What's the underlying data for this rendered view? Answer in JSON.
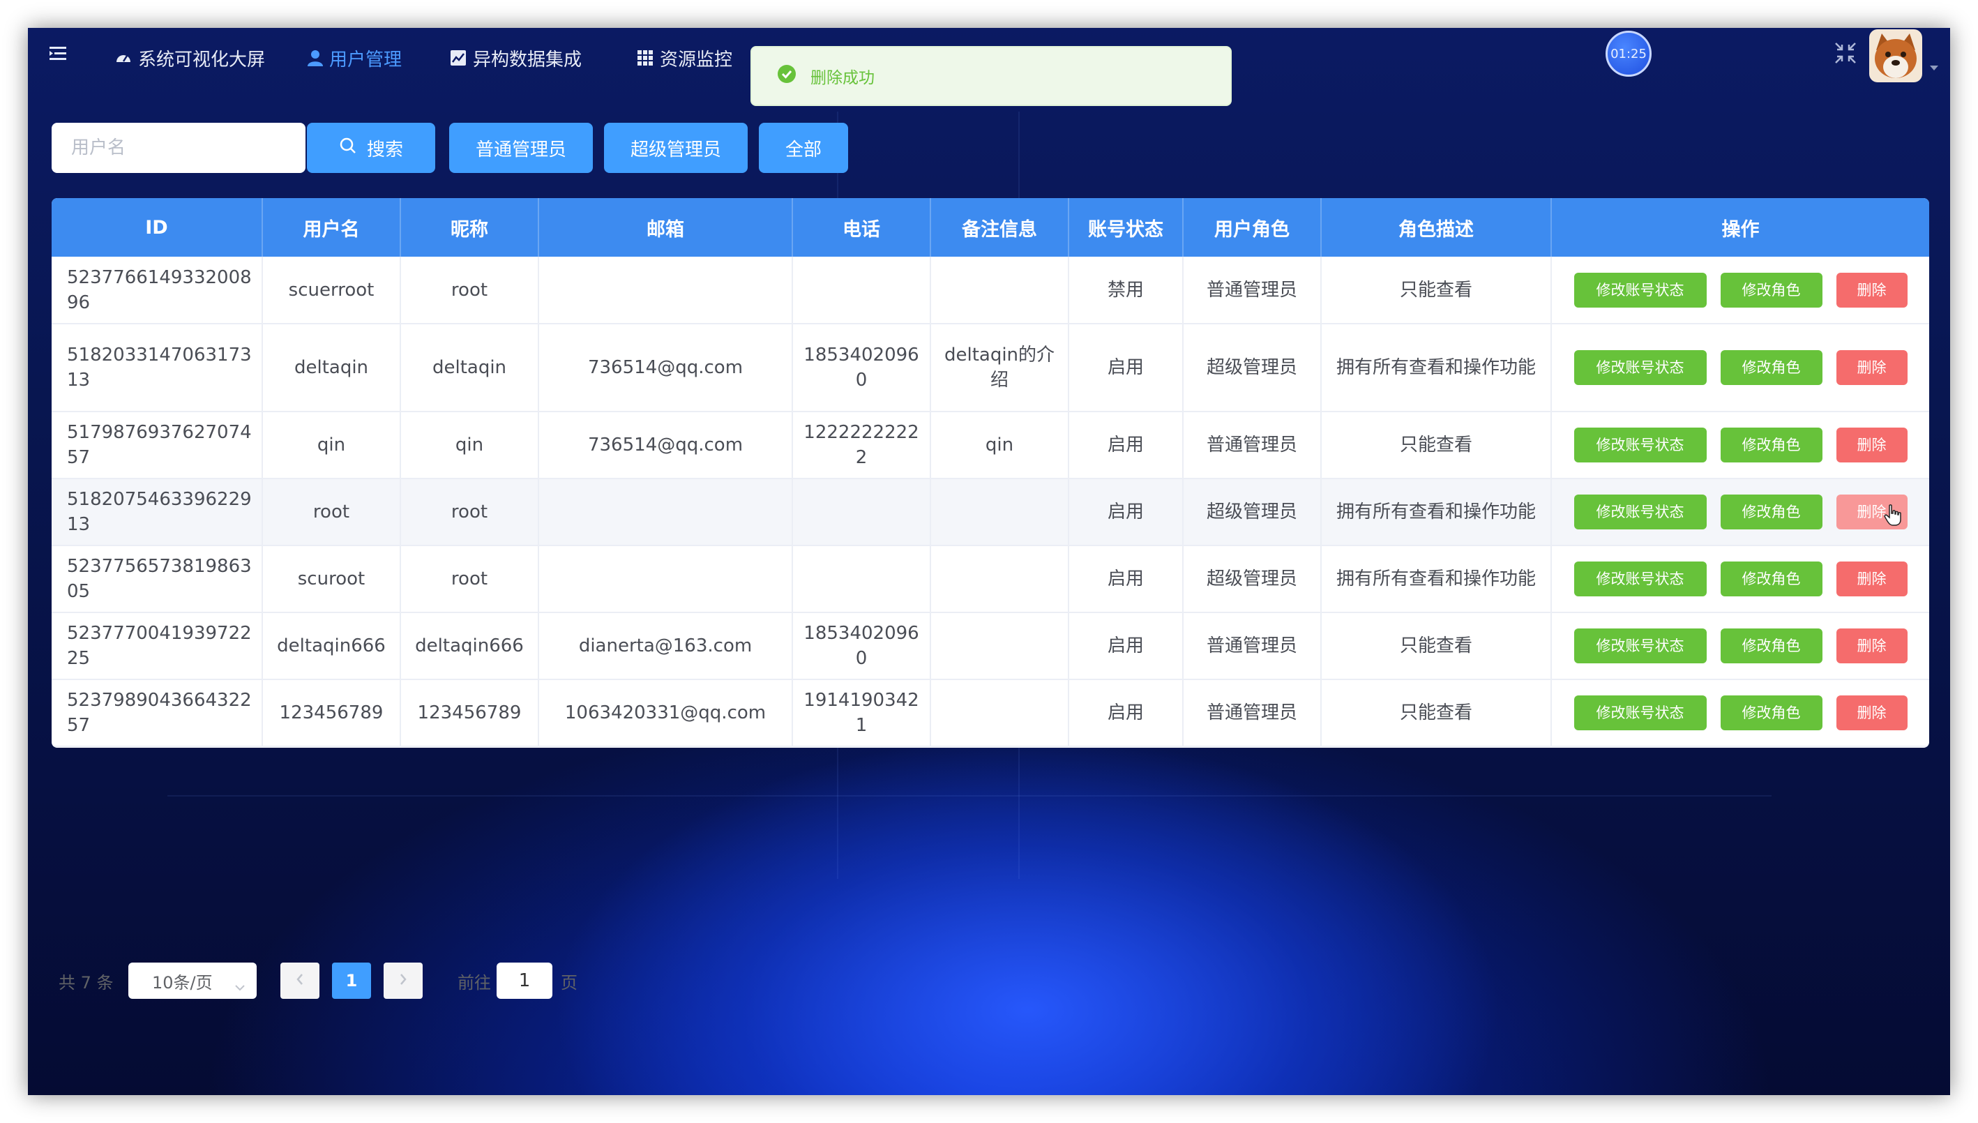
{
  "nav": {
    "items": [
      {
        "label": "系统可视化大屏",
        "icon": "dashboard-icon"
      },
      {
        "label": "用户管理",
        "icon": "user-icon"
      },
      {
        "label": "异构数据集成",
        "icon": "chart-icon"
      },
      {
        "label": "资源监控",
        "icon": "grid-icon"
      }
    ],
    "active_index": 1
  },
  "toast": {
    "message": "删除成功",
    "type": "success",
    "color": "#67c23a"
  },
  "timer": {
    "text": "01:25"
  },
  "search": {
    "placeholder": "用户名",
    "value": "",
    "search_label": "搜索",
    "filter_normal_label": "普通管理员",
    "filter_super_label": "超级管理员",
    "filter_all_label": "全部"
  },
  "table": {
    "columns": [
      "ID",
      "用户名",
      "昵称",
      "邮箱",
      "电话",
      "备注信息",
      "账号状态",
      "用户角色",
      "角色描述",
      "操作"
    ],
    "action_labels": {
      "status": "修改账号状态",
      "role": "修改角色",
      "delete": "删除"
    },
    "rows": [
      {
        "id": "523776614933200896",
        "username": "scuerroot",
        "nickname": "root",
        "email": "",
        "phone": "",
        "note": "",
        "status": "禁用",
        "role": "普通管理员",
        "desc": "只能查看"
      },
      {
        "id": "518203314706317313",
        "username": "deltaqin",
        "nickname": "deltaqin",
        "email": "736514@qq.com",
        "phone": "18534020960",
        "note": "deltaqin的介绍",
        "status": "启用",
        "role": "超级管理员",
        "desc": "拥有所有查看和操作功能"
      },
      {
        "id": "517987693762707457",
        "username": "qin",
        "nickname": "qin",
        "email": "736514@qq.com",
        "phone": "12222222222",
        "note": "qin",
        "status": "启用",
        "role": "普通管理员",
        "desc": "只能查看"
      },
      {
        "id": "518207546339622913",
        "username": "root",
        "nickname": "root",
        "email": "",
        "phone": "",
        "note": "",
        "status": "启用",
        "role": "超级管理员",
        "desc": "拥有所有查看和操作功能"
      },
      {
        "id": "523775657381986305",
        "username": "scuroot",
        "nickname": "root",
        "email": "",
        "phone": "",
        "note": "",
        "status": "启用",
        "role": "超级管理员",
        "desc": "拥有所有查看和操作功能"
      },
      {
        "id": "523777004193972225",
        "username": "deltaqin666",
        "nickname": "deltaqin666",
        "email": "dianerta@163.com",
        "phone": "18534020960",
        "note": "",
        "status": "启用",
        "role": "普通管理员",
        "desc": "只能查看"
      },
      {
        "id": "523798904366432257",
        "username": "123456789",
        "nickname": "123456789",
        "email": "1063420331@qq.com",
        "phone": "19141903421",
        "note": "",
        "status": "启用",
        "role": "普通管理员",
        "desc": "只能查看"
      }
    ],
    "hover_row_index": 3
  },
  "pagination": {
    "total_text": "共 7 条",
    "page_size": "10条/页",
    "current_page": "1",
    "goto_prefix": "前往",
    "goto_value": "1",
    "goto_suffix": "页"
  }
}
